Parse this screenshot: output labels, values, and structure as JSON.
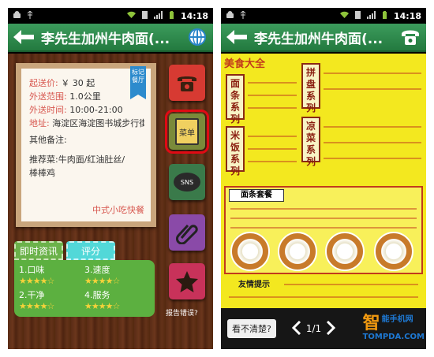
{
  "status_bar": {
    "time": "14:18"
  },
  "left_screen": {
    "title": "李先生加州牛肉面(...",
    "info": {
      "price_label": "起送价:",
      "price_value": "￥ 30 起",
      "range_label": "外送范围:",
      "range_value": "1.0公里",
      "time_label": "外送时间:",
      "time_value": "10:00-21:00",
      "address_label": "地址:",
      "address_value": "海淀区海淀图书城步行街",
      "notes_label": "其他备注:",
      "recommend_label": "推荐菜:",
      "recommend_value": "牛肉面/红油肚丝/",
      "recommend_value_2": "棒棒鸡",
      "tag": "标记餐厅",
      "category": "中式小吃快餐"
    },
    "side_buttons": [
      {
        "name": "phone",
        "icon": "phone-icon"
      },
      {
        "name": "menu",
        "label": "菜单",
        "icon": "notebook-icon"
      },
      {
        "name": "sns",
        "label": "SNS",
        "icon": "speech-bubble-icon"
      },
      {
        "name": "attach",
        "icon": "paperclip-icon"
      },
      {
        "name": "favorite",
        "icon": "star-icon"
      }
    ],
    "report_label": "报告错误?",
    "tabs": [
      {
        "label": "即时资讯"
      },
      {
        "label": "评分"
      }
    ],
    "ratings": [
      {
        "label": "1.口味",
        "stars": 4
      },
      {
        "label": "3.速度",
        "stars": 4
      },
      {
        "label": "2.干净",
        "stars": 4
      },
      {
        "label": "4.服务",
        "stars": 4
      }
    ]
  },
  "right_screen": {
    "title": "李先生加州牛肉面(...",
    "menu_heading": "美食大全",
    "menu_sections": [
      "面条系列",
      "米饭系列",
      "拼盘系列",
      "凉菜系列",
      "面条套餐"
    ],
    "notice_heading": "友情提示",
    "unclear_button": "看不清楚?",
    "page": "1/1",
    "watermark_top": "能手机网",
    "watermark_bottom": "TOMPDA.COM",
    "watermark_logo": "智"
  },
  "colors": {
    "title_green": "#237a3f",
    "menu_yellow": "#f3e81f",
    "selected_red": "#e00a14"
  }
}
